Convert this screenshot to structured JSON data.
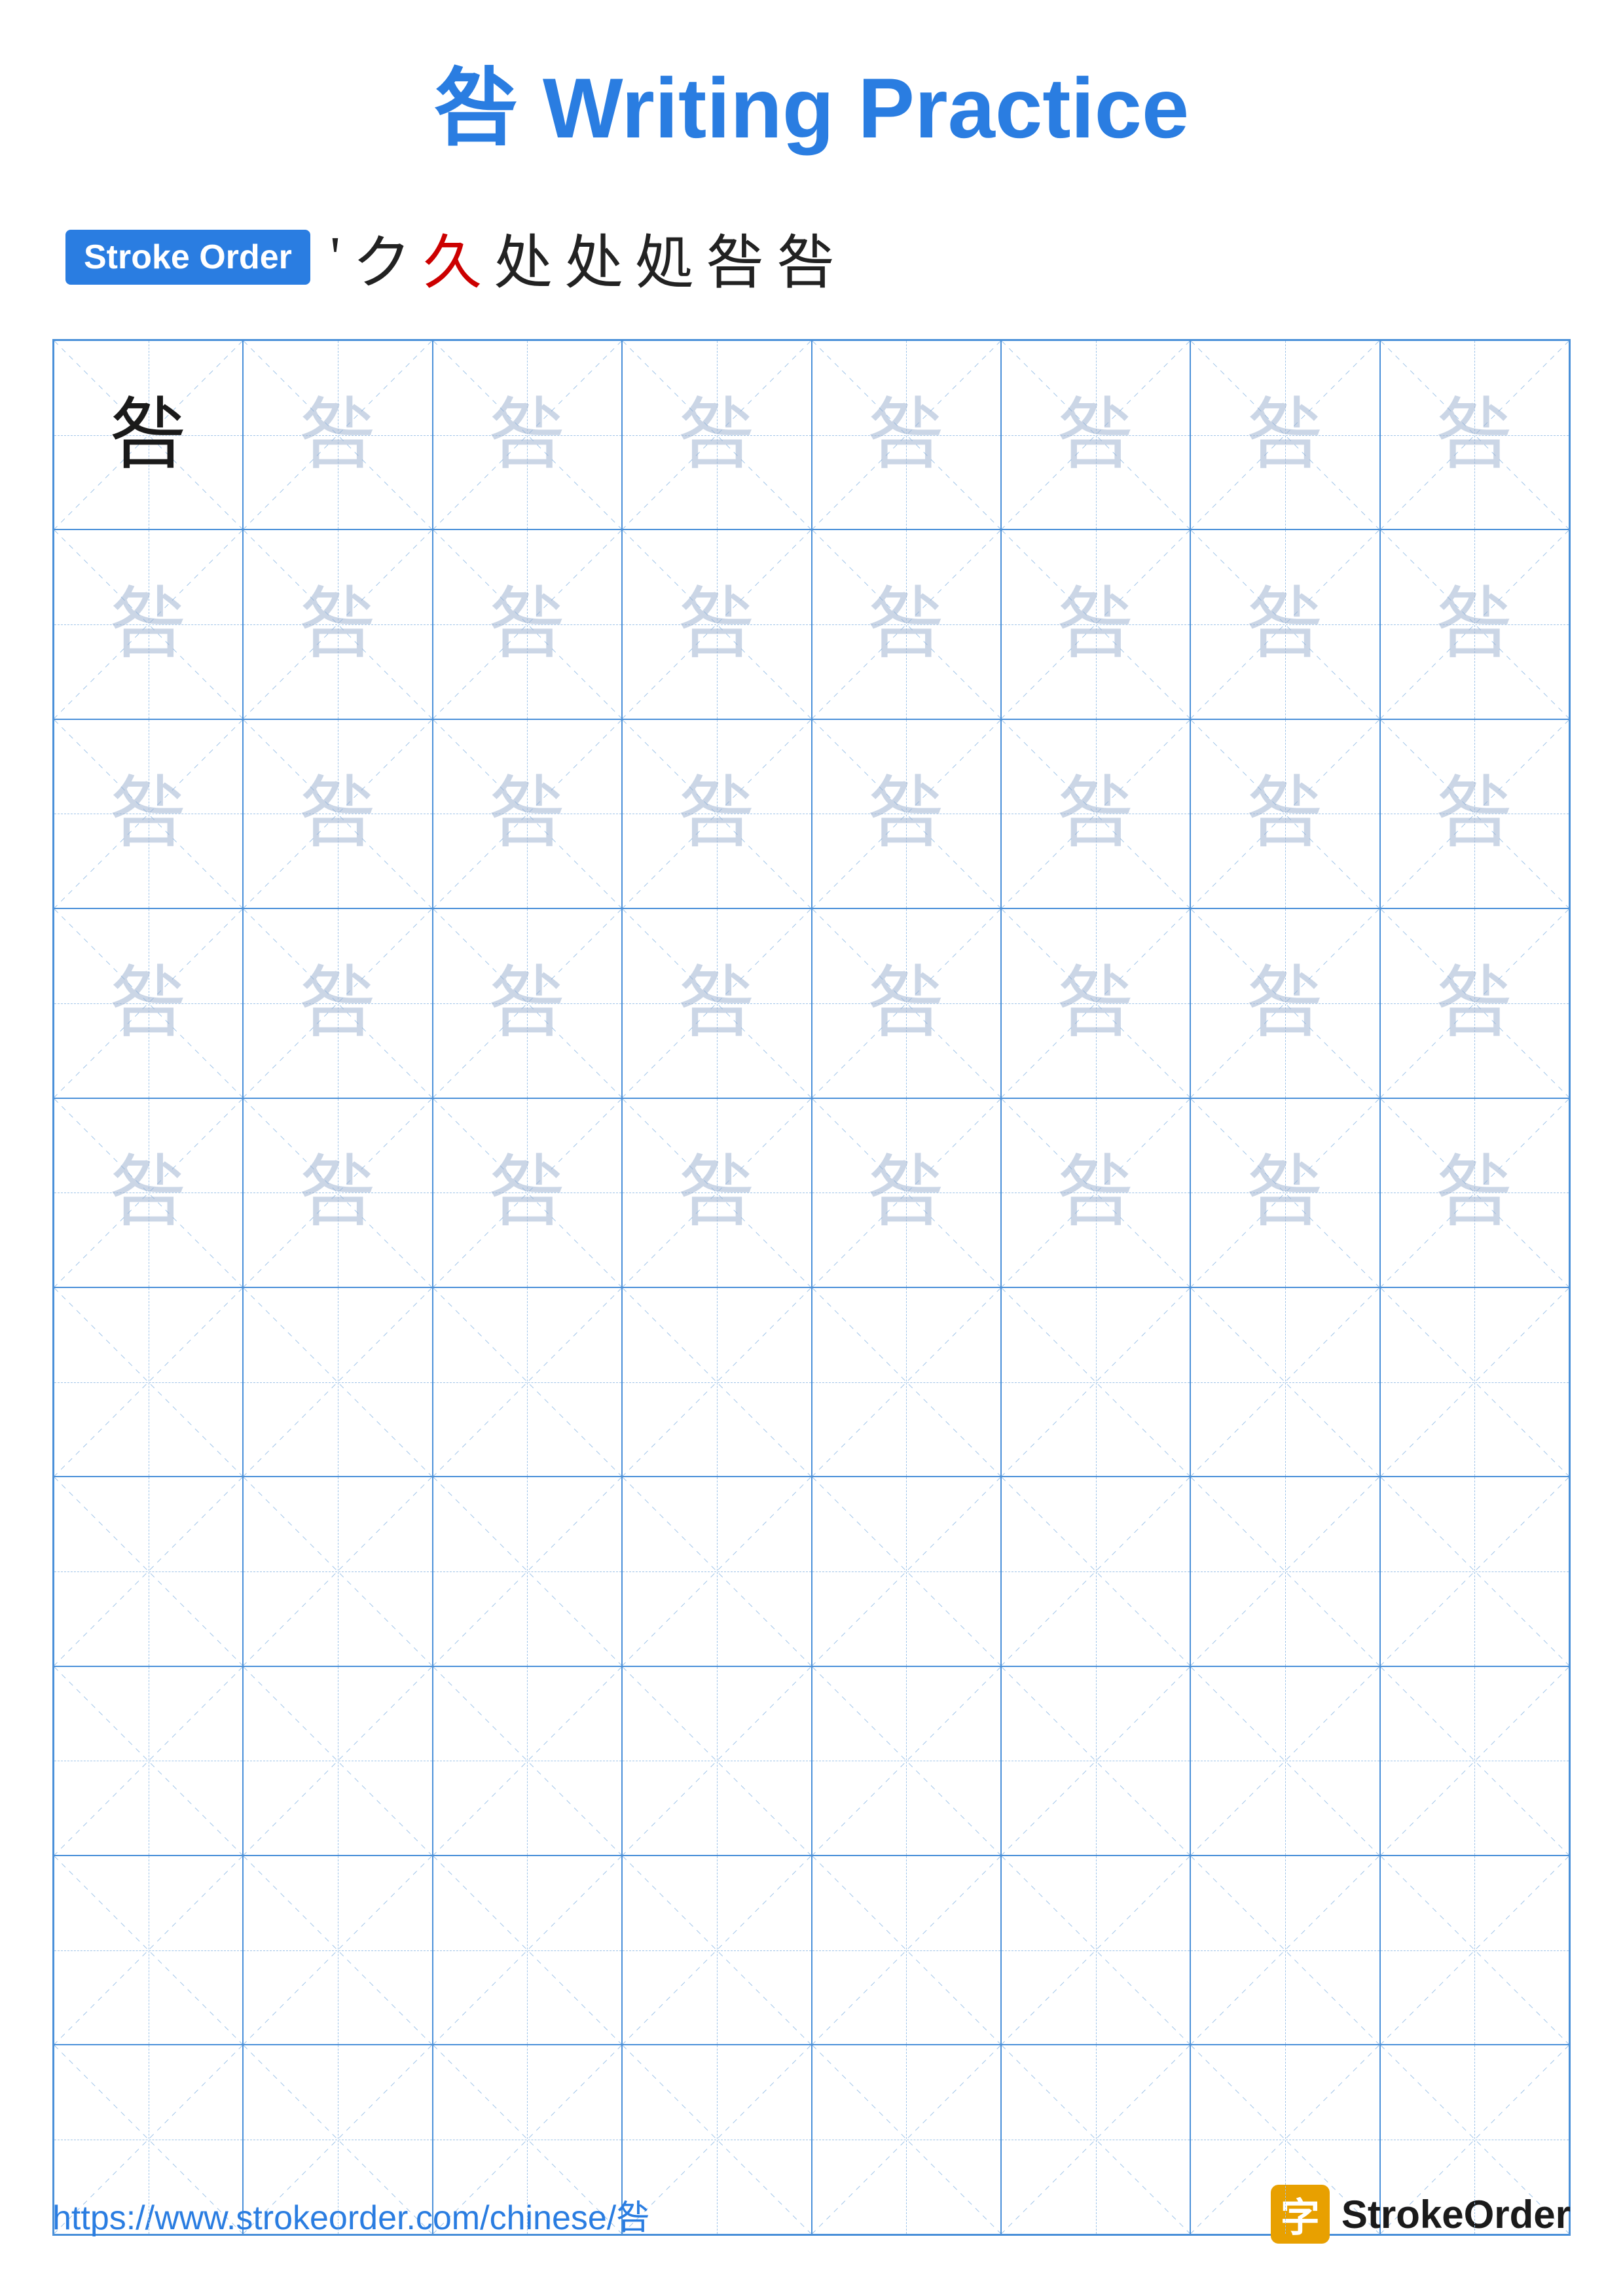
{
  "title": {
    "char": "咎",
    "label": "Writing Practice",
    "full": "咎 Writing Practice"
  },
  "stroke_order": {
    "badge": "Stroke Order",
    "sequence": [
      "'",
      "ク",
      "久",
      "处",
      "处",
      "処",
      "咎",
      "咎"
    ]
  },
  "grid": {
    "rows": 10,
    "cols": 8,
    "char": "咎",
    "dark_rows": [
      0
    ],
    "light_rows": [
      1,
      2,
      3,
      4
    ],
    "empty_rows": [
      5,
      6,
      7,
      8,
      9
    ],
    "dark_col": 0
  },
  "footer": {
    "url": "https://www.strokeorder.com/chinese/咎",
    "logo_text": "StrokeOrder",
    "logo_icon": "字"
  }
}
